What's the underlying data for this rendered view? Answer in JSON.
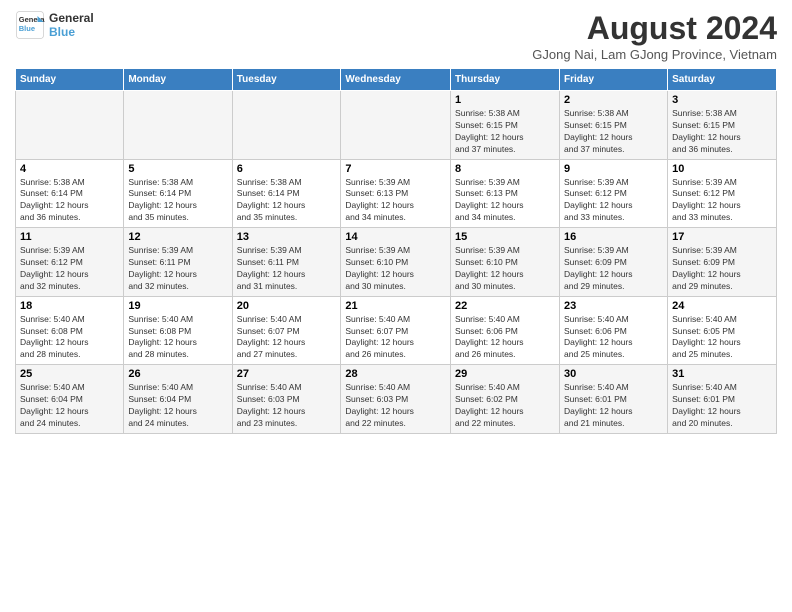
{
  "header": {
    "logo_line1": "General",
    "logo_line2": "Blue",
    "title": "August 2024",
    "subtitle": "GJong Nai, Lam GJong Province, Vietnam"
  },
  "days_of_week": [
    "Sunday",
    "Monday",
    "Tuesday",
    "Wednesday",
    "Thursday",
    "Friday",
    "Saturday"
  ],
  "weeks": [
    [
      {
        "day": "",
        "info": ""
      },
      {
        "day": "",
        "info": ""
      },
      {
        "day": "",
        "info": ""
      },
      {
        "day": "",
        "info": ""
      },
      {
        "day": "1",
        "info": "Sunrise: 5:38 AM\nSunset: 6:15 PM\nDaylight: 12 hours\nand 37 minutes."
      },
      {
        "day": "2",
        "info": "Sunrise: 5:38 AM\nSunset: 6:15 PM\nDaylight: 12 hours\nand 37 minutes."
      },
      {
        "day": "3",
        "info": "Sunrise: 5:38 AM\nSunset: 6:15 PM\nDaylight: 12 hours\nand 36 minutes."
      }
    ],
    [
      {
        "day": "4",
        "info": "Sunrise: 5:38 AM\nSunset: 6:14 PM\nDaylight: 12 hours\nand 36 minutes."
      },
      {
        "day": "5",
        "info": "Sunrise: 5:38 AM\nSunset: 6:14 PM\nDaylight: 12 hours\nand 35 minutes."
      },
      {
        "day": "6",
        "info": "Sunrise: 5:38 AM\nSunset: 6:14 PM\nDaylight: 12 hours\nand 35 minutes."
      },
      {
        "day": "7",
        "info": "Sunrise: 5:39 AM\nSunset: 6:13 PM\nDaylight: 12 hours\nand 34 minutes."
      },
      {
        "day": "8",
        "info": "Sunrise: 5:39 AM\nSunset: 6:13 PM\nDaylight: 12 hours\nand 34 minutes."
      },
      {
        "day": "9",
        "info": "Sunrise: 5:39 AM\nSunset: 6:12 PM\nDaylight: 12 hours\nand 33 minutes."
      },
      {
        "day": "10",
        "info": "Sunrise: 5:39 AM\nSunset: 6:12 PM\nDaylight: 12 hours\nand 33 minutes."
      }
    ],
    [
      {
        "day": "11",
        "info": "Sunrise: 5:39 AM\nSunset: 6:12 PM\nDaylight: 12 hours\nand 32 minutes."
      },
      {
        "day": "12",
        "info": "Sunrise: 5:39 AM\nSunset: 6:11 PM\nDaylight: 12 hours\nand 32 minutes."
      },
      {
        "day": "13",
        "info": "Sunrise: 5:39 AM\nSunset: 6:11 PM\nDaylight: 12 hours\nand 31 minutes."
      },
      {
        "day": "14",
        "info": "Sunrise: 5:39 AM\nSunset: 6:10 PM\nDaylight: 12 hours\nand 30 minutes."
      },
      {
        "day": "15",
        "info": "Sunrise: 5:39 AM\nSunset: 6:10 PM\nDaylight: 12 hours\nand 30 minutes."
      },
      {
        "day": "16",
        "info": "Sunrise: 5:39 AM\nSunset: 6:09 PM\nDaylight: 12 hours\nand 29 minutes."
      },
      {
        "day": "17",
        "info": "Sunrise: 5:39 AM\nSunset: 6:09 PM\nDaylight: 12 hours\nand 29 minutes."
      }
    ],
    [
      {
        "day": "18",
        "info": "Sunrise: 5:40 AM\nSunset: 6:08 PM\nDaylight: 12 hours\nand 28 minutes."
      },
      {
        "day": "19",
        "info": "Sunrise: 5:40 AM\nSunset: 6:08 PM\nDaylight: 12 hours\nand 28 minutes."
      },
      {
        "day": "20",
        "info": "Sunrise: 5:40 AM\nSunset: 6:07 PM\nDaylight: 12 hours\nand 27 minutes."
      },
      {
        "day": "21",
        "info": "Sunrise: 5:40 AM\nSunset: 6:07 PM\nDaylight: 12 hours\nand 26 minutes."
      },
      {
        "day": "22",
        "info": "Sunrise: 5:40 AM\nSunset: 6:06 PM\nDaylight: 12 hours\nand 26 minutes."
      },
      {
        "day": "23",
        "info": "Sunrise: 5:40 AM\nSunset: 6:06 PM\nDaylight: 12 hours\nand 25 minutes."
      },
      {
        "day": "24",
        "info": "Sunrise: 5:40 AM\nSunset: 6:05 PM\nDaylight: 12 hours\nand 25 minutes."
      }
    ],
    [
      {
        "day": "25",
        "info": "Sunrise: 5:40 AM\nSunset: 6:04 PM\nDaylight: 12 hours\nand 24 minutes."
      },
      {
        "day": "26",
        "info": "Sunrise: 5:40 AM\nSunset: 6:04 PM\nDaylight: 12 hours\nand 24 minutes."
      },
      {
        "day": "27",
        "info": "Sunrise: 5:40 AM\nSunset: 6:03 PM\nDaylight: 12 hours\nand 23 minutes."
      },
      {
        "day": "28",
        "info": "Sunrise: 5:40 AM\nSunset: 6:03 PM\nDaylight: 12 hours\nand 22 minutes."
      },
      {
        "day": "29",
        "info": "Sunrise: 5:40 AM\nSunset: 6:02 PM\nDaylight: 12 hours\nand 22 minutes."
      },
      {
        "day": "30",
        "info": "Sunrise: 5:40 AM\nSunset: 6:01 PM\nDaylight: 12 hours\nand 21 minutes."
      },
      {
        "day": "31",
        "info": "Sunrise: 5:40 AM\nSunset: 6:01 PM\nDaylight: 12 hours\nand 20 minutes."
      }
    ]
  ]
}
